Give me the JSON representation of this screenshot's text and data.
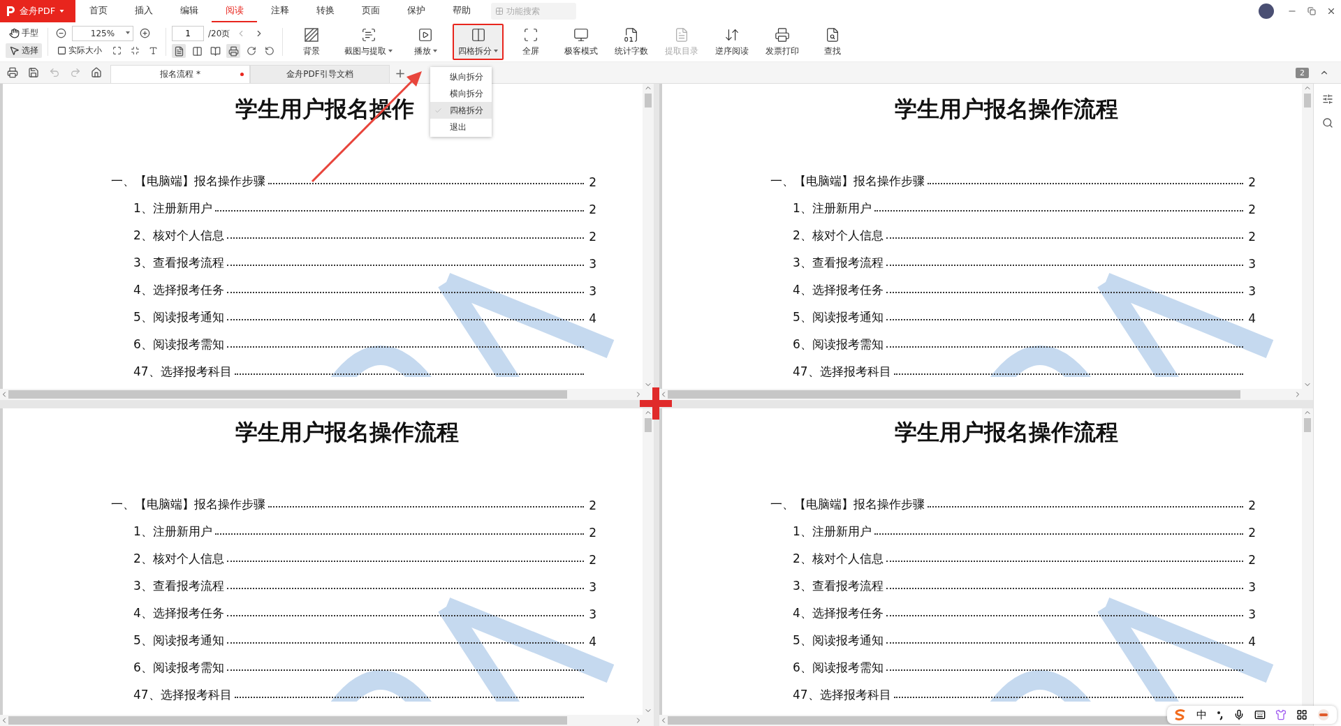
{
  "app": {
    "name": "金舟PDF"
  },
  "menu_tabs": [
    {
      "label": "首页",
      "selected": false
    },
    {
      "label": "插入",
      "selected": false
    },
    {
      "label": "编辑",
      "selected": false
    },
    {
      "label": "阅读",
      "selected": true
    },
    {
      "label": "注释",
      "selected": false
    },
    {
      "label": "转换",
      "selected": false
    },
    {
      "label": "页面",
      "selected": false
    },
    {
      "label": "保护",
      "selected": false
    },
    {
      "label": "帮助",
      "selected": false
    }
  ],
  "search": {
    "placeholder": "功能搜索"
  },
  "tool_modes": [
    {
      "label": "手型",
      "kind": "hand",
      "selected": false
    },
    {
      "label": "选择",
      "kind": "select",
      "selected": true
    }
  ],
  "zoom": {
    "value": "125%"
  },
  "actual_size": "实际大小",
  "page": {
    "value": "1",
    "total": "/20页"
  },
  "view_modes": [
    {
      "kind": "single",
      "selected": true
    },
    {
      "kind": "double",
      "selected": false
    },
    {
      "kind": "book",
      "selected": false
    },
    {
      "kind": "scroll",
      "selected": true
    }
  ],
  "ribbon": [
    {
      "label": "背景",
      "kind": "background",
      "dropdown": false,
      "disabled": false,
      "highlighted": false
    },
    {
      "label": "截图与提取",
      "kind": "screenshot",
      "dropdown": true,
      "disabled": false,
      "highlighted": false
    },
    {
      "label": "播放",
      "kind": "play",
      "dropdown": true,
      "disabled": false,
      "highlighted": false
    },
    {
      "label": "四格拆分",
      "kind": "split",
      "dropdown": true,
      "disabled": false,
      "highlighted": true
    },
    {
      "label": "全屏",
      "kind": "fullscreen",
      "dropdown": false,
      "disabled": false,
      "highlighted": false
    },
    {
      "label": "极客模式",
      "kind": "geek",
      "dropdown": false,
      "disabled": false,
      "highlighted": false
    },
    {
      "label": "统计字数",
      "kind": "count",
      "dropdown": false,
      "disabled": false,
      "highlighted": false
    },
    {
      "label": "提取目录",
      "kind": "toc",
      "dropdown": false,
      "disabled": true,
      "highlighted": false
    },
    {
      "label": "逆序阅读",
      "kind": "reverse",
      "dropdown": false,
      "disabled": false,
      "highlighted": false
    },
    {
      "label": "发票打印",
      "kind": "invoice",
      "dropdown": false,
      "disabled": false,
      "highlighted": false
    },
    {
      "label": "查找",
      "kind": "find",
      "dropdown": false,
      "disabled": false,
      "highlighted": false
    }
  ],
  "doc_tabs": [
    {
      "label": "报名流程 *",
      "selected": true,
      "unsaved": true
    },
    {
      "label": "金舟PDF引导文档",
      "selected": false,
      "unsaved": false
    }
  ],
  "new_tab": "+",
  "page_badge": "2",
  "split_menu": [
    {
      "label": "纵向拆分",
      "selected": false
    },
    {
      "label": "横向拆分",
      "selected": false
    },
    {
      "label": "四格拆分",
      "selected": true
    },
    {
      "label": "退出",
      "selected": false
    }
  ],
  "panes": [
    {
      "title": "学生用户报名操作",
      "toc": [
        {
          "text": "一、【电脑端】报名操作步骤",
          "page": "2",
          "children": [
            {
              "text": "1、注册新用户",
              "page": "2"
            },
            {
              "text": "2、核对个人信息",
              "page": "2"
            },
            {
              "text": "3、查看报考流程",
              "page": "3"
            },
            {
              "text": "4、选择报考任务",
              "page": "3"
            },
            {
              "text": "5、阅读报考通知",
              "page": "4"
            },
            {
              "text": "6、阅读报考需知"
            },
            {
              "text": "47、选择报考科目"
            }
          ]
        }
      ]
    },
    {
      "title": "学生用户报名操作流程",
      "toc": [
        {
          "text": "一、【电脑端】报名操作步骤",
          "page": "2",
          "children": [
            {
              "text": "1、注册新用户",
              "page": "2"
            },
            {
              "text": "2、核对个人信息",
              "page": "2"
            },
            {
              "text": "3、查看报考流程",
              "page": "3"
            },
            {
              "text": "4、选择报考任务",
              "page": "3"
            },
            {
              "text": "5、阅读报考通知",
              "page": "4"
            },
            {
              "text": "6、阅读报考需知"
            },
            {
              "text": "47、选择报考科目"
            }
          ]
        }
      ]
    },
    {
      "title": "学生用户报名操作流程",
      "toc": [
        {
          "text": "一、【电脑端】报名操作步骤",
          "page": "2",
          "children": [
            {
              "text": "1、注册新用户",
              "page": "2"
            },
            {
              "text": "2、核对个人信息",
              "page": "2"
            },
            {
              "text": "3、查看报考流程",
              "page": "3"
            },
            {
              "text": "4、选择报考任务",
              "page": "3"
            },
            {
              "text": "5、阅读报考通知",
              "page": "4"
            },
            {
              "text": "6、阅读报考需知"
            },
            {
              "text": "47、选择报考科目"
            }
          ]
        }
      ]
    },
    {
      "title": "学生用户报名操作流程",
      "toc": [
        {
          "text": "一、【电脑端】报名操作步骤",
          "page": "2",
          "children": [
            {
              "text": "1、注册新用户",
              "page": "2"
            },
            {
              "text": "2、核对个人信息",
              "page": "2"
            },
            {
              "text": "3、查看报考流程",
              "page": "3"
            },
            {
              "text": "4、选择报考任务",
              "page": "3"
            },
            {
              "text": "5、阅读报考通知",
              "page": "4"
            },
            {
              "text": "6、阅读报考需知"
            },
            {
              "text": "47、选择报考科目"
            }
          ]
        }
      ]
    }
  ],
  "ime": {
    "mode": "中"
  }
}
